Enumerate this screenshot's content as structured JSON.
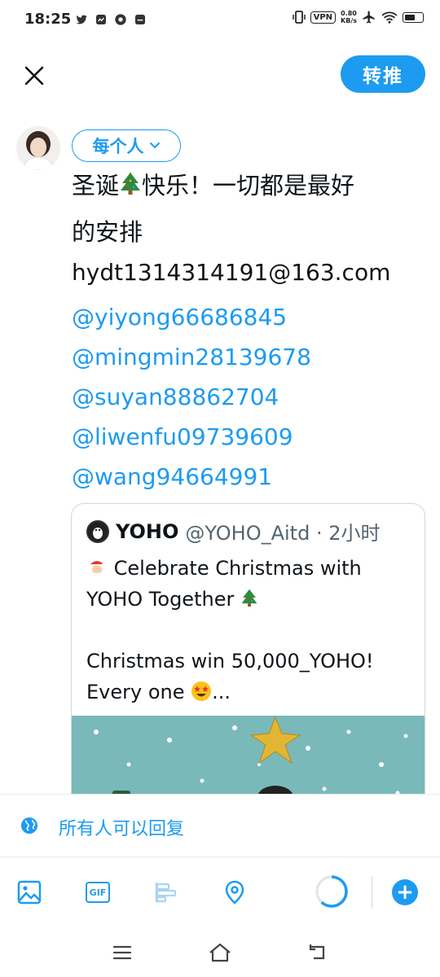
{
  "status_bar": {
    "time": "18:25",
    "vpn": "VPN",
    "net_speed_value": "0.80",
    "net_speed_unit": "KB/s",
    "battery_level": 0.48
  },
  "header": {
    "retweet_label": "转推"
  },
  "composer": {
    "audience_label": "每个人",
    "text_line1_before": "圣诞",
    "text_line1_after": "快乐！一切都是最好",
    "text_line2": "的安排",
    "email": "hydt1314314191@163.com",
    "mentions": [
      "@yiyong66686845",
      "@mingmin28139678",
      "@suyan88862704",
      "@liwenfu09739609",
      "@wang94664991"
    ]
  },
  "quote": {
    "name": "YOHO",
    "handle_time": "@YOHO_Aitd · 2小时",
    "line1": "Celebrate Christmas with",
    "line2": "YOHO Together",
    "line3": "Christmas win 50,000_YOHO!",
    "line4": "Every one",
    "line4_suffix": "..."
  },
  "reply_setting": {
    "label": "所有人可以回复"
  },
  "toolbar": {
    "gif_label": "GIF",
    "add_label": "+"
  },
  "colors": {
    "accent": "#1d9bf0",
    "text": "#0f1419",
    "muted": "#536471",
    "border": "#cfd9de"
  }
}
